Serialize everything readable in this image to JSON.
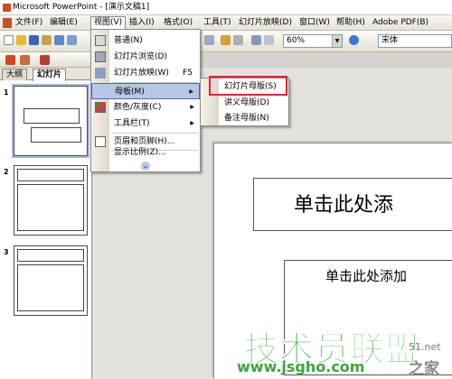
{
  "window": {
    "title": "Microsoft PowerPoint - [演示文稿1]"
  },
  "menubar": {
    "items": [
      {
        "label": "文件(F)"
      },
      {
        "label": "编辑(E)"
      },
      {
        "label": "视图(V)"
      },
      {
        "label": "插入(I)"
      },
      {
        "label": "格式(O)"
      },
      {
        "label": "工具(T)"
      },
      {
        "label": "幻灯片放映(D)"
      },
      {
        "label": "窗口(W)"
      },
      {
        "label": "帮助(H)"
      },
      {
        "label": "Adobe PDF(B)"
      }
    ],
    "active": "视图(V)"
  },
  "toolbar": {
    "zoom": "60%",
    "font": "宋体"
  },
  "panel": {
    "tabs": [
      {
        "label": "大纲"
      },
      {
        "label": "幻灯片"
      }
    ],
    "slides": [
      {
        "number": "1"
      },
      {
        "number": "2"
      },
      {
        "number": "3"
      }
    ]
  },
  "view_menu": {
    "items": [
      {
        "label": "普通(N)",
        "icon": "normal-view-icon"
      },
      {
        "label": "幻灯片浏览(D)",
        "icon": "slide-sorter-icon"
      },
      {
        "label": "幻灯片放映(W)",
        "shortcut": "F5",
        "icon": "slideshow-icon"
      },
      {
        "label": "母板(M)",
        "submenu": true
      },
      {
        "label": "颜色/灰度(C)",
        "submenu": true,
        "icon": "color-icon"
      },
      {
        "label": "工具栏(T)",
        "submenu": true
      },
      {
        "label": "页眉和页脚(H)...",
        "icon": "header-footer-icon"
      },
      {
        "label": "显示比例(Z)..."
      }
    ]
  },
  "master_submenu": {
    "items": [
      {
        "label": "幻灯片母版(S)"
      },
      {
        "label": "讲义母版(D)"
      },
      {
        "label": "备注母版(N)"
      }
    ]
  },
  "slide": {
    "title_placeholder": "单击此处添",
    "subtitle_placeholder": "单击此处添加"
  },
  "watermark": {
    "text": "技术员联盟",
    "site": "www.jsgho.com",
    "partial": "51.net",
    "suffix": "之家"
  },
  "colors": {
    "highlight_box": "#e0262f",
    "menu_highlight": "#b6c7e8",
    "watermark": "#3aa63a"
  }
}
